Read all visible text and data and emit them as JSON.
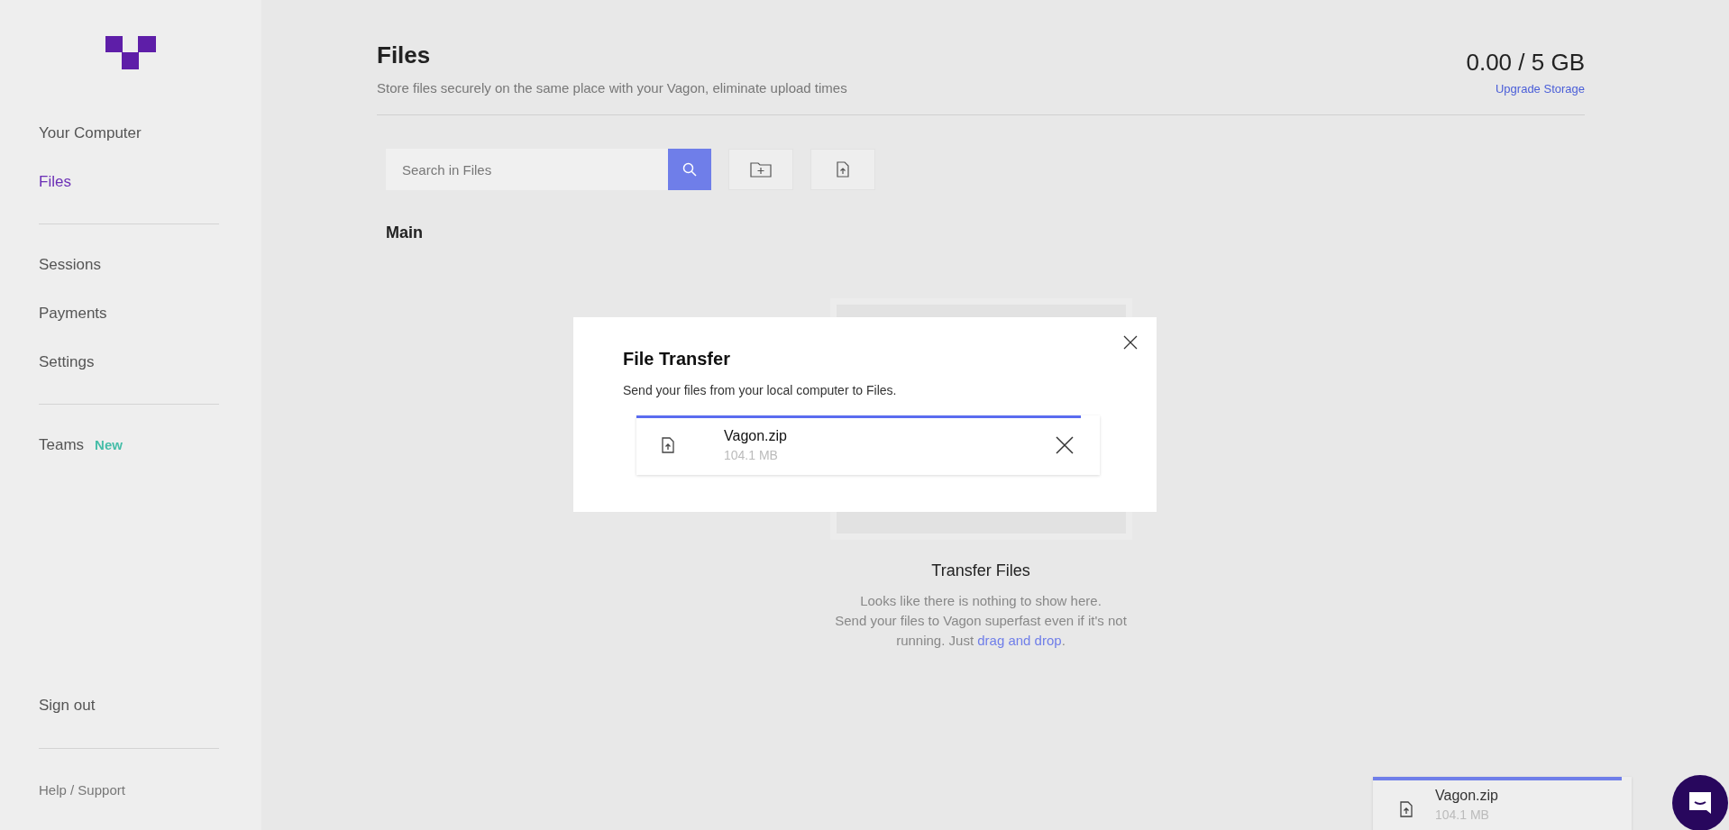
{
  "sidebar": {
    "groups": [
      [
        {
          "label": "Your Computer",
          "selected": false
        },
        {
          "label": "Files",
          "selected": true
        }
      ],
      [
        {
          "label": "Sessions",
          "selected": false
        },
        {
          "label": "Payments",
          "selected": false
        },
        {
          "label": "Settings",
          "selected": false
        }
      ],
      [
        {
          "label": "Teams",
          "selected": false,
          "badge": "New"
        }
      ]
    ],
    "sign_out": "Sign out",
    "help": "Help / Support"
  },
  "header": {
    "title": "Files",
    "subtitle": "Store files securely on the same place with your Vagon, eliminate upload times",
    "storage": "0.00 / 5 GB",
    "upgrade_link": "Upgrade Storage"
  },
  "toolbar": {
    "search": {
      "placeholder": "Search in Files"
    }
  },
  "folder": "Main",
  "empty_state": {
    "title": "Transfer Files",
    "text_lines": [
      "Looks like there is nothing to show here.",
      "Send your files to Vagon superfast even if it's not"
    ],
    "text_last": "running. Just ",
    "link": "drag and drop",
    "text_end": "."
  },
  "modal": {
    "title": "File Transfer",
    "text": "Send your files from your local computer to Files.",
    "transfers": [
      {
        "name": "Vagon.zip",
        "size": "104.1 MB",
        "level": 0.96
      }
    ]
  },
  "toast": {
    "transfers": [
      {
        "name": "Vagon.zip",
        "size": "104.1 MB",
        "level": 0.96
      }
    ]
  }
}
